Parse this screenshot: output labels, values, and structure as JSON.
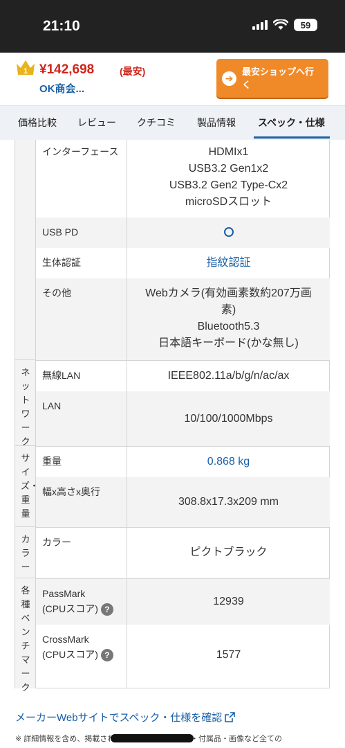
{
  "status_bar": {
    "time": "21:10",
    "battery": "59"
  },
  "header": {
    "rank_badge": "1",
    "price": "¥142,698",
    "price_tag": "(最安)",
    "shop_name": "OK商会...",
    "cta_label": "最安ショップへ行く",
    "cta_icon": "arrow-right-icon",
    "price_color": "#d0241b",
    "cta_color": "#f08a28"
  },
  "tabs": [
    {
      "label": "価格比較"
    },
    {
      "label": "レビュー"
    },
    {
      "label": "クチコミ"
    },
    {
      "label": "製品情報"
    },
    {
      "label": "スペック・仕様",
      "active": true
    }
  ],
  "spec": {
    "interface": {
      "label": "インターフェース",
      "lines": [
        "HDMIx1",
        "USB3.2 Gen1x2",
        "USB3.2 Gen2 Type-Cx2",
        "microSDスロット"
      ]
    },
    "usb_pd": {
      "label": "USB PD",
      "value": "○"
    },
    "biometric": {
      "label": "生体認証",
      "value": "指紋認証"
    },
    "other": {
      "label": "その他",
      "lines": [
        "Webカメラ(有効画素数約207万画",
        "素)",
        "Bluetooth5.3",
        "日本語キーボード(かな無し)"
      ]
    },
    "network": {
      "title": "ネットワーク",
      "wireless_label": "無線LAN",
      "wireless_value": "IEEE802.11a/b/g/n/ac/ax",
      "lan_label": "LAN",
      "lan_value": "10/100/1000Mbps"
    },
    "size_weight": {
      "title": "サイズ・重量",
      "weight_label": "重量",
      "weight_value": "0.868 kg",
      "dims_label": "幅x高さx奥行",
      "dims_value": "308.8x17.3x209 mm"
    },
    "color": {
      "title": "カラー",
      "label": "カラー",
      "value": "ピクトブラック"
    },
    "benchmark": {
      "title": "各種ベンチマーク",
      "passmark_label_1": "PassMark",
      "passmark_label_2": "(CPUスコア)",
      "passmark_value": "12939",
      "crossmark_label_1": "CrossMark",
      "crossmark_label_2": "(CPUスコア)",
      "crossmark_value": "1577",
      "help_glyph": "?"
    }
  },
  "footer": {
    "maker_link": "メーカーWebサイトでスペック・仕様を確認",
    "footnote": "※ 詳細情報を含め、掲載されている価格や詳細情報・付属品・画像など全ての"
  },
  "link_color": "#1a5fa7"
}
